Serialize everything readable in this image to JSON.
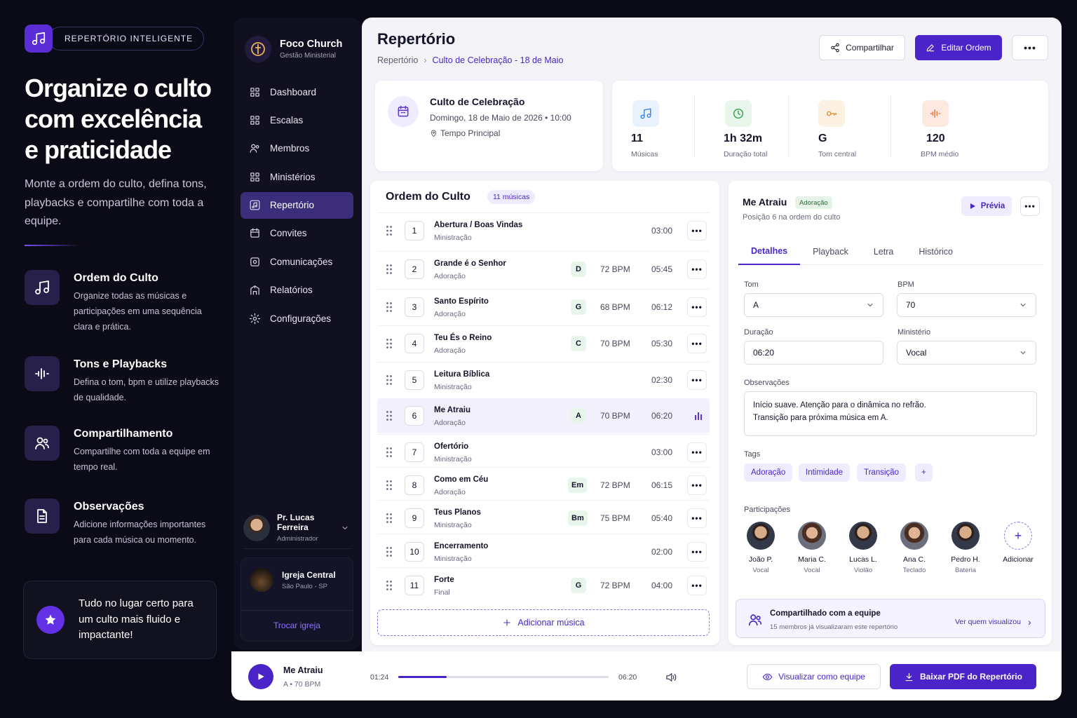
{
  "marketing": {
    "badge": "REPERTÓRIO INTELIGENTE",
    "headline": "Organize o culto com excelência e praticidade",
    "subtitle": "Monte a ordem do culto, defina tons, playbacks e compartilhe com toda a equipe.",
    "features": [
      {
        "title": "Ordem do Culto",
        "desc": "Organize todas as músicas e participações em uma sequência clara e prática.",
        "icon": "music-note-icon"
      },
      {
        "title": "Tons e Playbacks",
        "desc": "Defina o tom, bpm e utilize playbacks de qualidade.",
        "icon": "audio-wave-icon"
      },
      {
        "title": "Compartilhamento",
        "desc": "Compartilhe com toda a equipe em tempo real.",
        "icon": "users-icon"
      },
      {
        "title": "Observações",
        "desc": "Adicione informações importantes para cada música ou momento.",
        "icon": "document-icon"
      }
    ],
    "promo": "Tudo no lugar certo para um culto mais fluido e impactante!"
  },
  "sidebar": {
    "brand_name": "Foco Church",
    "brand_sub": "Gestão Ministerial",
    "items": [
      {
        "label": "Dashboard",
        "icon": "grid-icon"
      },
      {
        "label": "Escalas",
        "icon": "grid-icon"
      },
      {
        "label": "Membros",
        "icon": "users-icon"
      },
      {
        "label": "Ministérios",
        "icon": "grid-icon"
      },
      {
        "label": "Repertório",
        "icon": "music-note-icon",
        "active": true
      },
      {
        "label": "Convites",
        "icon": "calendar-icon"
      },
      {
        "label": "Comunicações",
        "icon": "broadcast-icon"
      },
      {
        "label": "Relatórios",
        "icon": "building-icon"
      },
      {
        "label": "Configurações",
        "icon": "gear-icon"
      }
    ],
    "user_name": "Pr. Lucas Ferreira",
    "user_role": "Administrador",
    "church_name": "Igreja Central",
    "church_location": "São Paulo - SP",
    "church_switch": "Trocar igreja"
  },
  "header": {
    "title": "Repertório",
    "breadcrumb_root": "Repertório",
    "breadcrumb_current": "Culto de Celebração - 18 de Maio",
    "share_label": "Compartilhar",
    "edit_label": "Editar Ordem",
    "more_label": "•••"
  },
  "event": {
    "title": "Culto de Celebração",
    "date": "Domingo, 18 de Maio de 2026 • 10:00",
    "place": "Tempo Principal"
  },
  "stats": [
    {
      "value": "11",
      "label": "Músicas",
      "color": "#2f7fe0",
      "bg": "#e8f1fc"
    },
    {
      "value": "1h 32m",
      "label": "Duração total",
      "color": "#2c9a45",
      "bg": "#e7f5ea"
    },
    {
      "value": "G",
      "label": "Tom central",
      "color": "#d8902b",
      "bg": "#fcf1e2"
    },
    {
      "value": "120",
      "label": "BPM médio",
      "color": "#e76a2c",
      "bg": "#fde9e0"
    }
  ],
  "order": {
    "title": "Ordem do Culto",
    "count": "11 músicas",
    "add_label": "Adicionar música",
    "songs": [
      {
        "n": "1",
        "title": "Abertura / Boas Vindas",
        "sub": "Ministração",
        "key": "",
        "bpm": "",
        "dur": "03:00"
      },
      {
        "n": "2",
        "title": "Grande é o Senhor",
        "sub": "Adoração",
        "key": "D",
        "bpm": "72 BPM",
        "dur": "05:45"
      },
      {
        "n": "3",
        "title": "Santo Espírito",
        "sub": "Adoração",
        "key": "G",
        "bpm": "68 BPM",
        "dur": "06:12"
      },
      {
        "n": "4",
        "title": "Teu És o Reino",
        "sub": "Adoração",
        "key": "C",
        "bpm": "70 BPM",
        "dur": "05:30"
      },
      {
        "n": "5",
        "title": "Leitura Bíblica",
        "sub": "Ministração",
        "key": "",
        "bpm": "",
        "dur": "02:30"
      },
      {
        "n": "6",
        "title": "Me Atraiu",
        "sub": "Adoração",
        "key": "A",
        "bpm": "70 BPM",
        "dur": "06:20",
        "selected": true
      },
      {
        "n": "7",
        "title": "Ofertório",
        "sub": "Ministração",
        "key": "",
        "bpm": "",
        "dur": "03:00"
      },
      {
        "n": "8",
        "title": "Como em Céu",
        "sub": "Adoração",
        "key": "Em",
        "bpm": "72 BPM",
        "dur": "06:15"
      },
      {
        "n": "9",
        "title": "Teus Planos",
        "sub": "Ministração",
        "key": "Bm",
        "bpm": "75 BPM",
        "dur": "05:40"
      },
      {
        "n": "10",
        "title": "Encerramento",
        "sub": "Ministração",
        "key": "",
        "bpm": "",
        "dur": "02:00"
      },
      {
        "n": "11",
        "title": "Forte",
        "sub": "Final",
        "key": "G",
        "bpm": "72 BPM",
        "dur": "04:00"
      }
    ]
  },
  "detail": {
    "title": "Me Atraiu",
    "tag": "Adoração",
    "position": "Posição 6 na ordem do culto",
    "preview_label": "Prévia",
    "tabs": [
      "Detalhes",
      "Playback",
      "Letra",
      "Histórico"
    ],
    "tom_label": "Tom",
    "tom_value": "A",
    "bpm_label": "BPM",
    "bpm_value": "70",
    "duracao_label": "Duração",
    "duracao_value": "06:20",
    "ministerio_label": "Ministério",
    "ministerio_value": "Vocal",
    "obs_label": "Observações",
    "obs_line1": "Início suave. Atenção para o dinâmica no refrão.",
    "obs_line2": "Transição para próxima música em A.",
    "tags_label": "Tags",
    "tags": [
      "Adoração",
      "Intimidade",
      "Transição"
    ],
    "add_tag": "+",
    "participants_label": "Participações",
    "participants": [
      {
        "name": "João P.",
        "role": "Vocal"
      },
      {
        "name": "Maria C.",
        "role": "Vocal"
      },
      {
        "name": "Lucas L.",
        "role": "Violão"
      },
      {
        "name": "Ana C.",
        "role": "Teclado"
      },
      {
        "name": "Pedro H.",
        "role": "Bateria"
      }
    ],
    "add_participant": "Adicionar",
    "shared_title": "Compartilhado com a equipe",
    "shared_sub": "15 membros já visualizaram este repertório",
    "shared_link": "Ver quem visualizou"
  },
  "player": {
    "title": "Me Atraiu",
    "sub": "A • 70 BPM",
    "current": "01:24",
    "total": "06:20",
    "progress": 0.23,
    "view_label": "Visualizar como equipe",
    "pdf_label": "Baixar PDF do Repertório"
  }
}
